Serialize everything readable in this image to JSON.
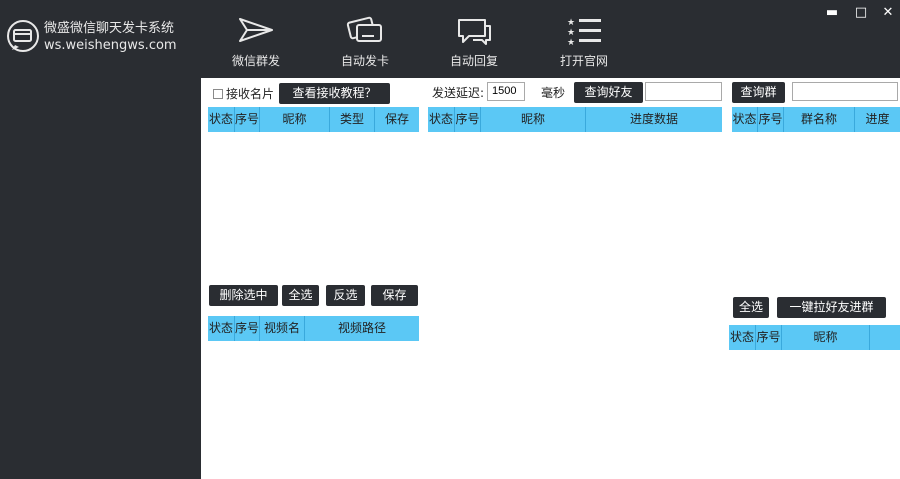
{
  "app": {
    "title": "微盛微信聊天发卡系统",
    "url": "ws.weishengws.com"
  },
  "nav": [
    {
      "label": "微信群发",
      "icon": "send-plane-icon"
    },
    {
      "label": "自动发卡",
      "icon": "cards-icon"
    },
    {
      "label": "自动回复",
      "icon": "chat-bubble-icon"
    },
    {
      "label": "打开官网",
      "icon": "star-list-icon"
    }
  ],
  "window": {
    "minimize": "▬",
    "maximize": "□",
    "close": "✕"
  },
  "contacts": {
    "receive_card_label": "接收名片",
    "tutorial_button": "查看接收教程？",
    "columns": [
      "状态",
      "序号",
      "昵称",
      "类型",
      "保存"
    ]
  },
  "sending": {
    "delay_label": "发送延迟:",
    "delay_value": "1500",
    "unit": "毫秒",
    "query_friends_button": "查询好友",
    "friend_search_value": "",
    "columns": [
      "状态",
      "序号",
      "昵称",
      "进度数据"
    ]
  },
  "groups": {
    "query_groups_button": "查询群",
    "group_search_value": "",
    "columns": [
      "状态",
      "序号",
      "群名称",
      "进度"
    ]
  },
  "video": {
    "delete_selected": "删除选中",
    "select_all": "全选",
    "invert_select": "反选",
    "save": "保存",
    "columns": [
      "状态",
      "序号",
      "视频名",
      "视频路径"
    ]
  },
  "invite": {
    "select_all": "全选",
    "pull_button": "一键拉好友进群",
    "columns": [
      "状态",
      "序号",
      "昵称"
    ]
  }
}
